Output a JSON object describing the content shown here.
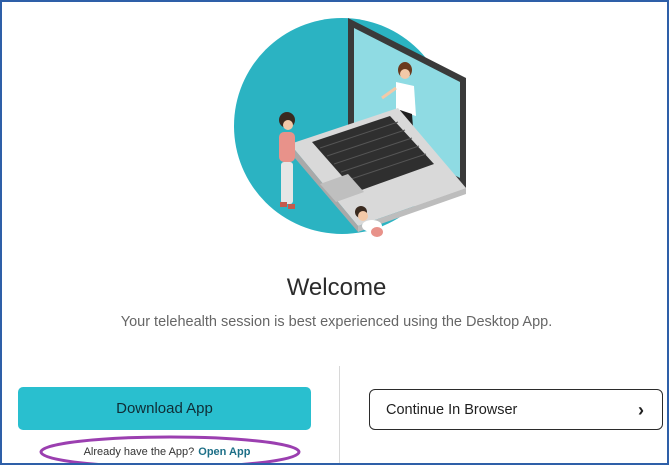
{
  "welcome": {
    "title": "Welcome",
    "subtitle": "Your telehealth session is best experienced using the Desktop App."
  },
  "actions": {
    "download_label": "Download App",
    "already_text": "Already have the App?",
    "open_app_label": "Open App",
    "continue_label": "Continue In Browser",
    "continue_icon": "chevron-right-icon",
    "continue_glyph": "›"
  },
  "colors": {
    "accent": "#29bfcf",
    "hero_circle": "#2bb3c2",
    "link": "#1d6f87",
    "highlight_ellipse": "#9b3fb0",
    "frame_border": "#2e5fa8"
  },
  "icons": {
    "hero": "telehealth-laptop-illustration"
  }
}
